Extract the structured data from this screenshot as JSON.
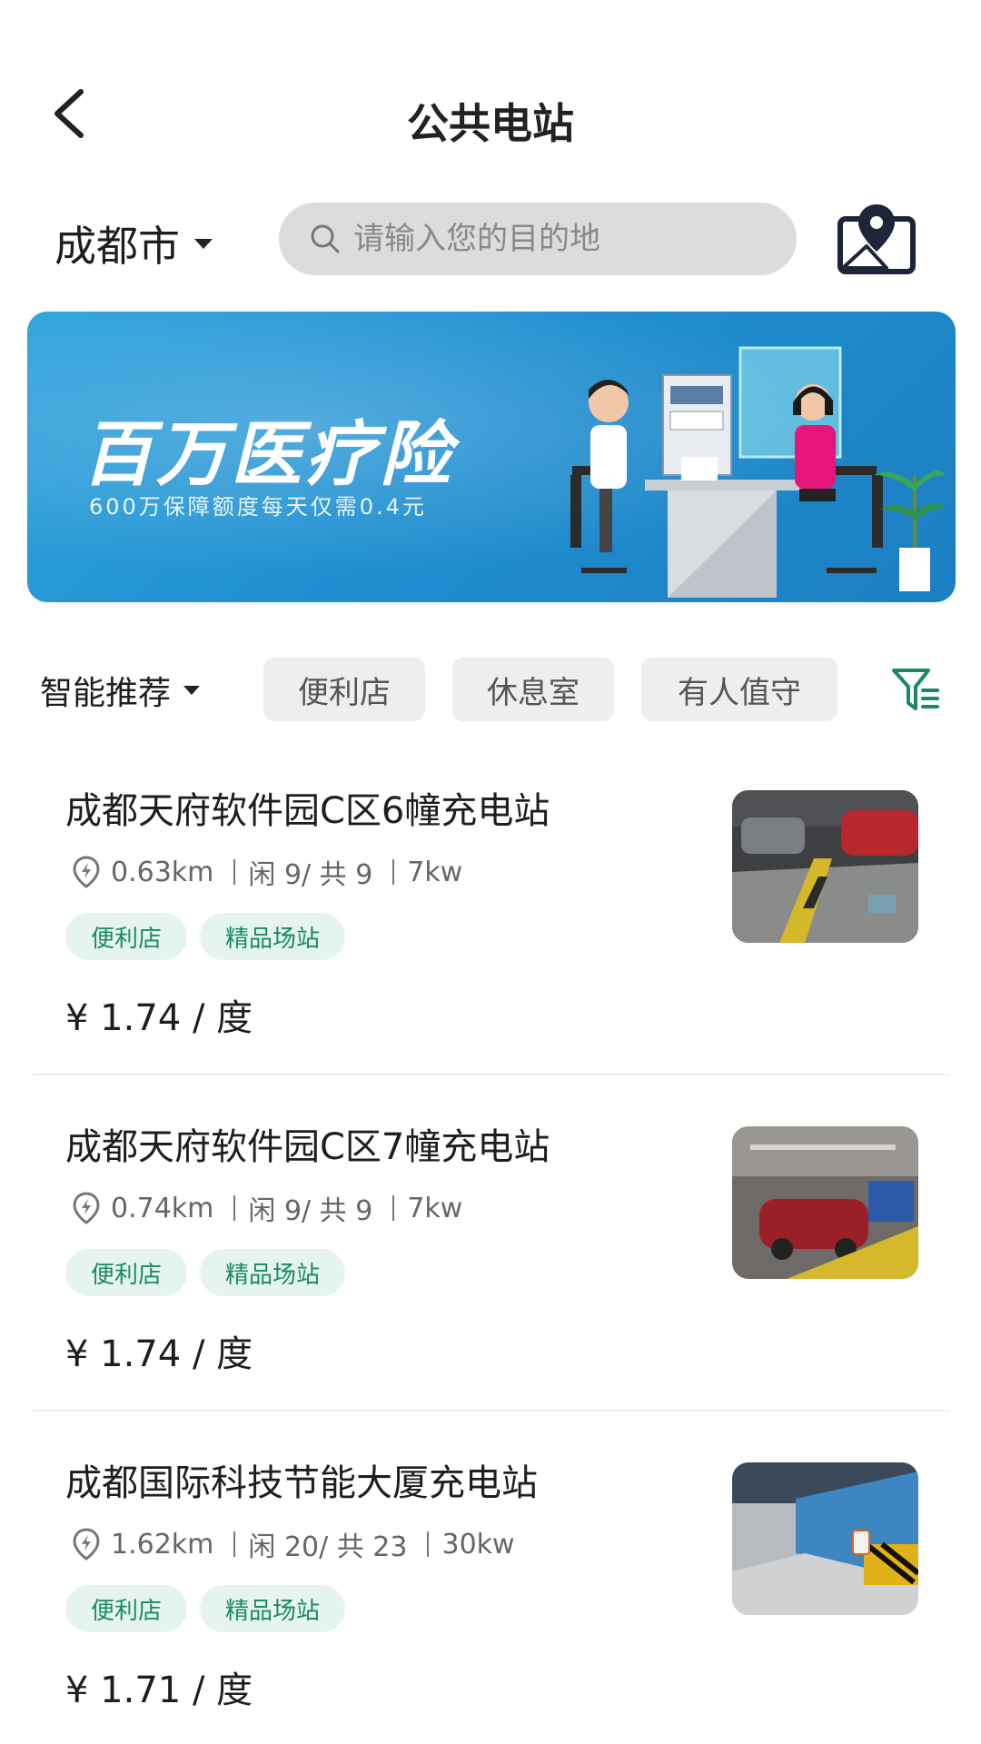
{
  "header": {
    "title": "公共电站",
    "back_icon": "chevron-left-icon"
  },
  "search": {
    "city": "成都市",
    "placeholder": "请输入您的目的地",
    "map_icon": "map-pin-icon"
  },
  "banner": {
    "title": "百万医疗险",
    "subtitle": "600万保障额度每天仅需0.4元"
  },
  "filters": {
    "sort_label": "智能推荐",
    "chips": [
      "便利店",
      "休息室",
      "有人值守"
    ],
    "filter_icon": "filter-icon"
  },
  "colors": {
    "accent_green": "#1a8a63",
    "tag_bg": "#e6f4ef",
    "banner_blue": "#1f8fd0"
  },
  "stations": [
    {
      "name": "成都天府软件园C区6幢充电站",
      "distance": "0.63km",
      "availability": "闲 9/ 共 9",
      "power": "7kw",
      "tags": [
        "便利店",
        "精品场站"
      ],
      "price": "¥ 1.74 / 度"
    },
    {
      "name": "成都天府软件园C区7幢充电站",
      "distance": "0.74km",
      "availability": "闲 9/ 共 9",
      "power": "7kw",
      "tags": [
        "便利店",
        "精品场站"
      ],
      "price": "¥ 1.74 / 度"
    },
    {
      "name": "成都国际科技节能大厦充电站",
      "distance": "1.62km",
      "availability": "闲 20/ 共 23",
      "power": "30kw",
      "tags": [
        "便利店",
        "精品场站"
      ],
      "price": "¥ 1.71 / 度"
    }
  ]
}
